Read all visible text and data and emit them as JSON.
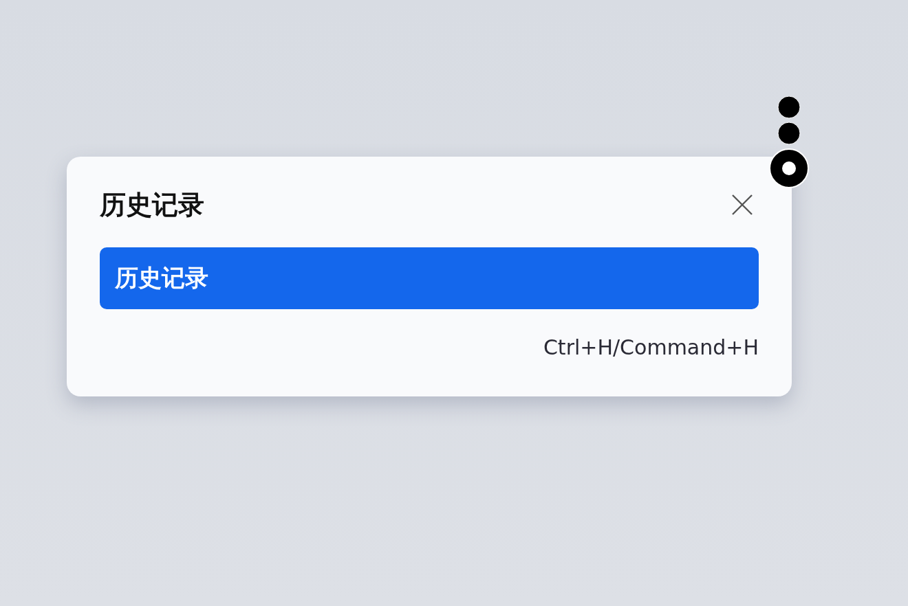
{
  "dialog": {
    "title": "历史记录",
    "items": [
      {
        "label": "历史记录",
        "selected": true
      }
    ],
    "shortcut": "Ctrl+H/Command+H"
  }
}
